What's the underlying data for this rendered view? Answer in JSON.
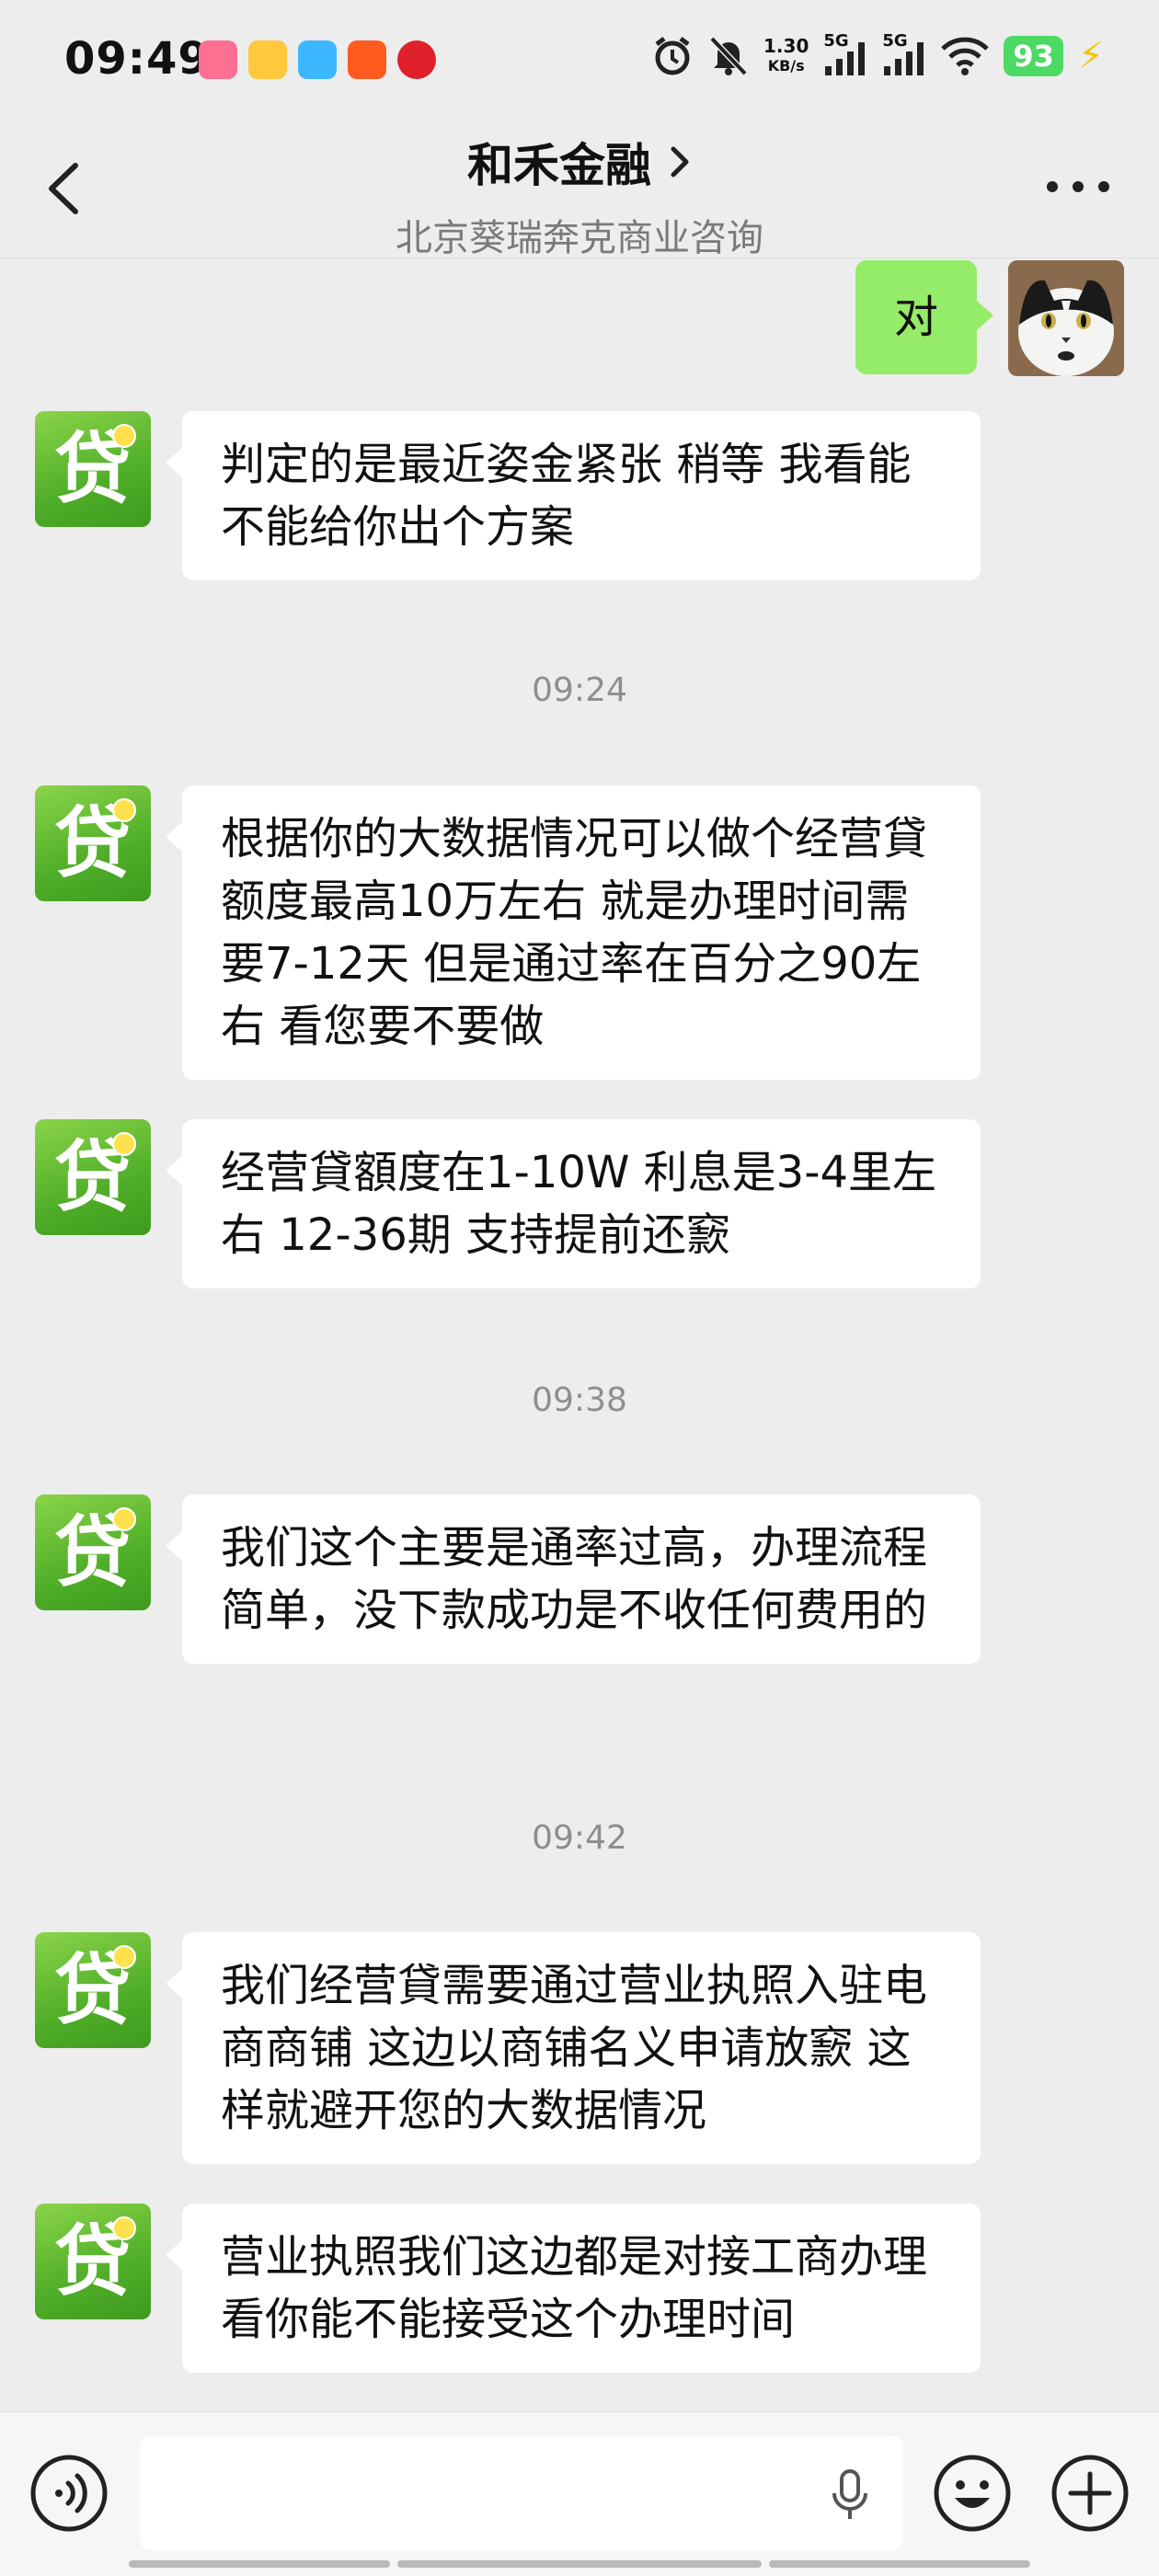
{
  "status_bar": {
    "time": "09:49",
    "net_speed_value": "1.30",
    "net_speed_unit": "KB/s",
    "signal1_label": "5G",
    "signal2_label": "5G",
    "battery": "93"
  },
  "header": {
    "title": "和禾金融",
    "subtitle": "北京葵瑞奔克商业咨询"
  },
  "loan_avatar_glyph": "贷",
  "user_message": "对",
  "messages": [
    {
      "text": "判定的是最近姿金紧张 稍等 我看能不能给你出个方案"
    },
    {
      "text": "根据你的大数据情况可以做个经营貸 额度最高10万左右 就是办理时间需要7-12天 但是通过率在百分之90左右 看您要不要做"
    },
    {
      "text": "经营貸額度在1-10W 利息是3-4里左右 12-36期 支持提前还窾"
    },
    {
      "text": "我们这个主要是通率过高，办理流程简单，没下款成功是不收任何费用的"
    },
    {
      "text": "我们经营貸需要通过营业执照入驻电商商铺  这边以商铺名义申请放窾 这样就避开您的大数据情况"
    },
    {
      "text": "营业执照我们这边都是对接工商办理 看你能不能接受这个办理时间"
    }
  ],
  "timestamps": [
    "09:24",
    "09:38",
    "09:42"
  ],
  "input": {
    "value": "",
    "placeholder": ""
  },
  "icons": {
    "back": "chevron-left-icon",
    "title_arrow": "chevron-right-icon",
    "more": "more-dots-icon",
    "voice": "voice-icon",
    "mic": "mic-icon",
    "emoji": "emoji-icon",
    "plus": "plus-icon"
  },
  "colors": {
    "background": "#ededed",
    "outgoing_bubble": "#95ec69",
    "incoming_bubble": "#ffffff",
    "loan_avatar_green": "#4fae28",
    "battery": "#4cd964"
  }
}
